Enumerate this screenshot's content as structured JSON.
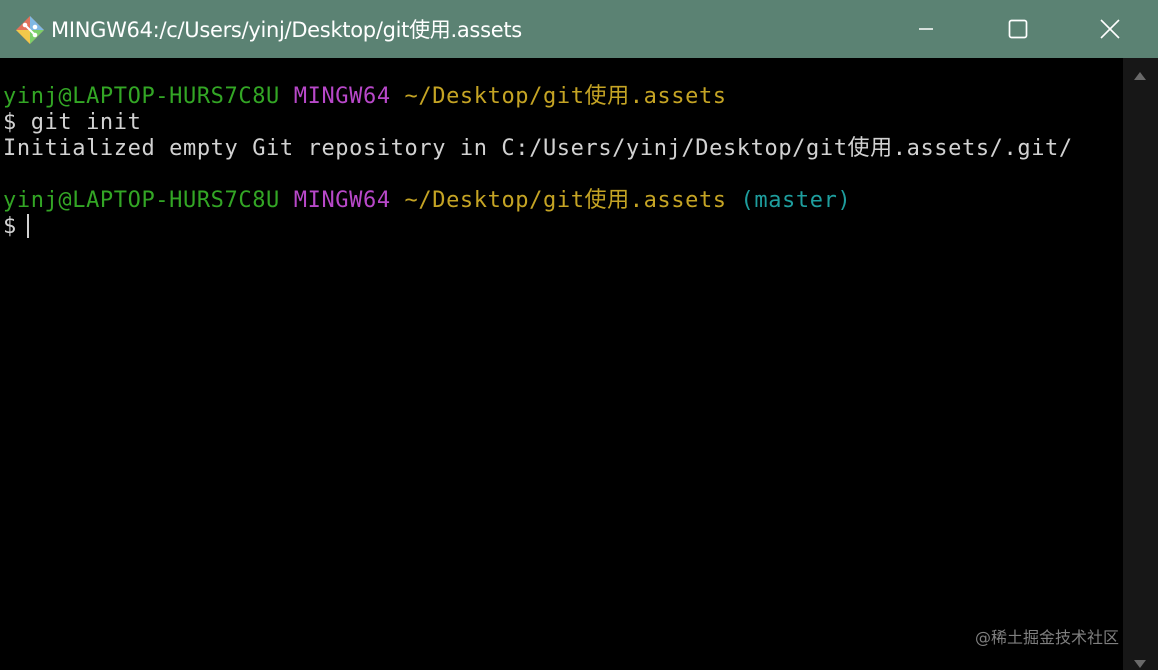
{
  "window": {
    "title": "MINGW64:/c/Users/yinj/Desktop/git使用.assets",
    "app_icon": "git-for-windows-icon",
    "controls": [
      "minimize-icon",
      "maximize-icon",
      "close-icon"
    ]
  },
  "colors": {
    "titlebar": "#5b8273",
    "user_host": "#33a625",
    "msystem": "#b848c9",
    "path": "#c5a424",
    "branch": "#1e9e9e",
    "output": "#d2d2d2",
    "background": "#000000"
  },
  "terminal": {
    "prompt1": {
      "user_host": "yinj@LAPTOP-HURS7C8U",
      "msystem": "MINGW64",
      "path": "~/Desktop/git使用.assets"
    },
    "command1": "$ git init",
    "output1": "Initialized empty Git repository in C:/Users/yinj/Desktop/git使用.assets/.git/",
    "prompt2": {
      "user_host": "yinj@LAPTOP-HURS7C8U",
      "msystem": "MINGW64",
      "path": "~/Desktop/git使用.assets",
      "branch": "(master)"
    },
    "current_input_prompt": "$"
  },
  "watermark": "@稀土掘金技术社区"
}
